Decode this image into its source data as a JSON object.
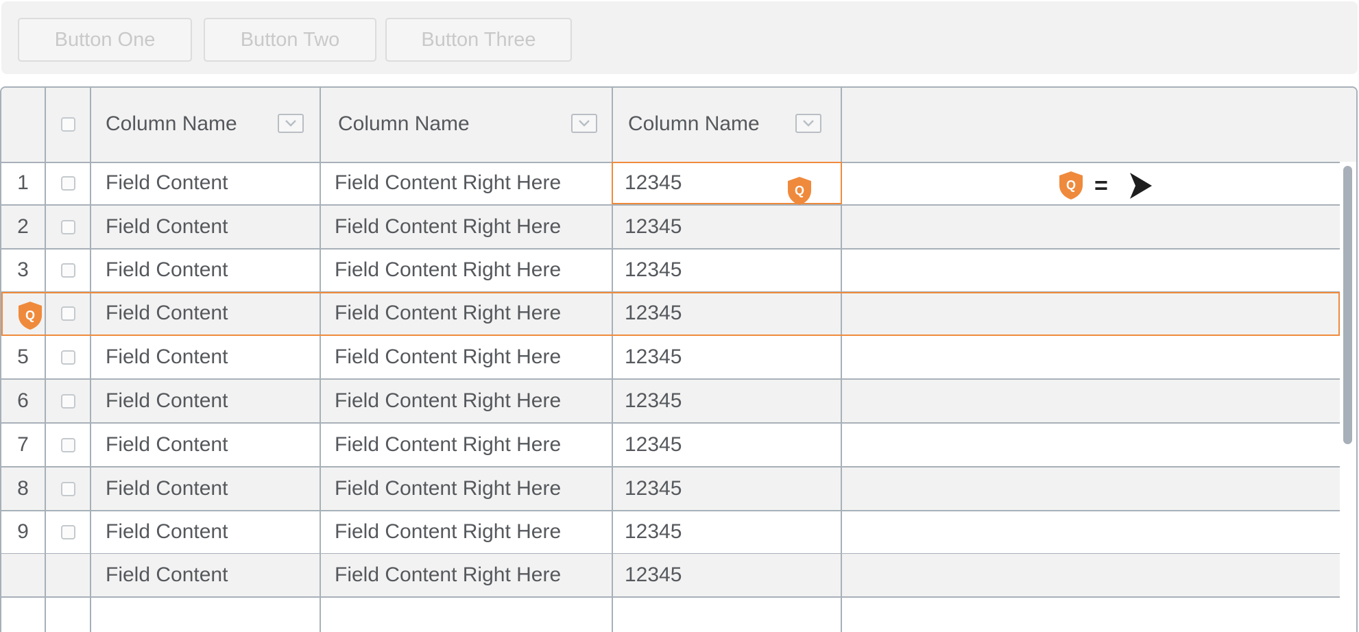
{
  "toolbar": {
    "buttons": [
      "Button One",
      "Button Two",
      "Button Three"
    ]
  },
  "grid": {
    "columns": [
      "Column Name",
      "Column Name",
      "Column Name"
    ],
    "rows": [
      {
        "num": "1",
        "a": "Field Content",
        "b": "Field Content Right Here",
        "c": "12345"
      },
      {
        "num": "2",
        "a": "Field Content",
        "b": "Field Content Right Here",
        "c": "12345"
      },
      {
        "num": "3",
        "a": "Field Content",
        "b": "Field Content Right Here",
        "c": "12345"
      },
      {
        "num": "",
        "a": "Field Content",
        "b": "Field Content Right Here",
        "c": "12345"
      },
      {
        "num": "5",
        "a": "Field Content",
        "b": "Field Content Right Here",
        "c": "12345"
      },
      {
        "num": "6",
        "a": "Field Content",
        "b": "Field Content Right Here",
        "c": "12345"
      },
      {
        "num": "7",
        "a": "Field Content",
        "b": "Field Content Right Here",
        "c": "12345"
      },
      {
        "num": "8",
        "a": "Field Content",
        "b": "Field Content Right Here",
        "c": "12345"
      },
      {
        "num": "9",
        "a": "Field Content",
        "b": "Field Content Right Here",
        "c": "12345"
      },
      {
        "num": "",
        "a": "Field Content",
        "b": "Field Content Right Here",
        "c": "12345"
      }
    ]
  },
  "legend": {
    "symbol": "="
  },
  "badge_letter": "Q",
  "colors": {
    "accent": "#ef8a3c",
    "grid_line": "#a7b0b8",
    "alt_row": "#f2f2f2",
    "text": "#55585c"
  },
  "icons": {
    "badge": "q-shield-icon",
    "pointer": "cursor-arrow-icon",
    "dropdown": "chevron-down-icon",
    "checkbox": "checkbox-icon"
  }
}
